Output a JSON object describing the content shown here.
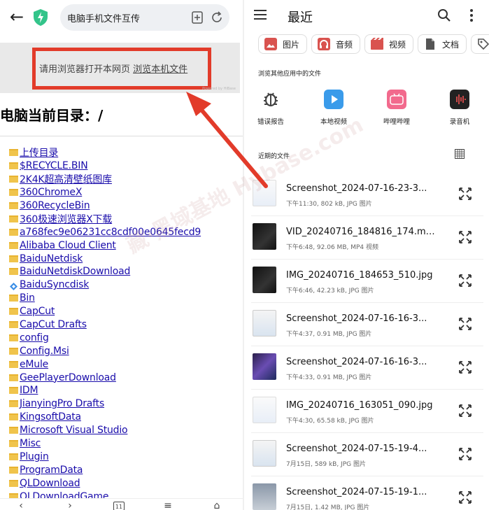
{
  "browser": {
    "url_text": "电脑手机文件互传",
    "banner_text": "请用浏览器打开本网页",
    "banner_link": "浏览本机文件",
    "powered": "Powered by HiBase",
    "dir_title": "电脑当前目录：/",
    "items": [
      {
        "name": "上传目录",
        "icon": "folder-icon"
      },
      {
        "name": "$RECYCLE.BIN",
        "icon": "folder-icon"
      },
      {
        "name": "2K4K超高清壁纸图库",
        "icon": "folder-icon"
      },
      {
        "name": "360ChromeX",
        "icon": "folder-icon"
      },
      {
        "name": "360RecycleBin",
        "icon": "folder-icon"
      },
      {
        "name": "360极速浏览器X下载",
        "icon": "folder-icon"
      },
      {
        "name": "a768fec9e06231cc8cdf00e0645fecd9",
        "icon": "folder-icon"
      },
      {
        "name": "Alibaba Cloud Client",
        "icon": "folder-icon"
      },
      {
        "name": "BaiduNetdisk",
        "icon": "folder-icon"
      },
      {
        "name": "BaiduNetdiskDownload",
        "icon": "folder-icon"
      },
      {
        "name": "BaiduSyncdisk",
        "icon": "sync-folder-icon"
      },
      {
        "name": "Bin",
        "icon": "folder-icon"
      },
      {
        "name": "CapCut",
        "icon": "folder-icon"
      },
      {
        "name": "CapCut Drafts",
        "icon": "folder-icon"
      },
      {
        "name": "config",
        "icon": "folder-icon"
      },
      {
        "name": "Config.Msi",
        "icon": "folder-icon"
      },
      {
        "name": "eMule",
        "icon": "folder-icon"
      },
      {
        "name": "GeePlayerDownload",
        "icon": "folder-icon"
      },
      {
        "name": "IDM",
        "icon": "folder-icon"
      },
      {
        "name": "JianyingPro Drafts",
        "icon": "folder-icon"
      },
      {
        "name": "KingsoftData",
        "icon": "folder-icon"
      },
      {
        "name": "Microsoft Visual Studio",
        "icon": "folder-icon"
      },
      {
        "name": "Misc",
        "icon": "folder-icon"
      },
      {
        "name": "Plugin",
        "icon": "folder-icon"
      },
      {
        "name": "ProgramData",
        "icon": "folder-icon"
      },
      {
        "name": "QLDownload",
        "icon": "folder-icon"
      },
      {
        "name": "QLDownloadGame",
        "icon": "folder-icon"
      }
    ],
    "bottom_nav": [
      {
        "icon": "back-icon"
      },
      {
        "icon": "forward-icon"
      },
      {
        "icon": "tabs-icon",
        "label": "11"
      },
      {
        "icon": "menu-icon"
      },
      {
        "icon": "home-icon"
      }
    ]
  },
  "watermark": "藏·黑域基地 Hybase.com",
  "files_app": {
    "title": "最近",
    "chips": [
      {
        "label": "图片",
        "icon": "image-icon",
        "color": "#d9534f"
      },
      {
        "label": "音频",
        "icon": "headphones-icon",
        "color": "#d9534f"
      },
      {
        "label": "视频",
        "icon": "video-icon",
        "color": "#d9534f"
      },
      {
        "label": "文档",
        "icon": "document-icon",
        "color": "#555555"
      },
      {
        "label": "",
        "icon": "tag-icon",
        "color": "#555555"
      }
    ],
    "browse_label": "浏览其他应用中的文件",
    "apps": [
      {
        "label": "错误报告",
        "icon": "bug-icon",
        "color": "#444444"
      },
      {
        "label": "本地视频",
        "icon": "play-icon",
        "color": "#3a9bea"
      },
      {
        "label": "哔哩哔哩",
        "icon": "bilibili-icon",
        "color": "#f26a8d"
      },
      {
        "label": "录音机",
        "icon": "recorder-icon",
        "color": "#222222"
      }
    ],
    "recent_label": "近期的文件",
    "recent": [
      {
        "name": "Screenshot_2024-07-16-23-3...",
        "meta": "下午11:30, 802 kB, JPG 图片",
        "thumb": "light"
      },
      {
        "name": "VID_20240716_184816_174.mp...",
        "meta": "下午6:48, 92.06 MB, MP4 视频",
        "thumb": "dark"
      },
      {
        "name": "IMG_20240716_184653_510.jpg",
        "meta": "下午6:46, 42.23 kB, JPG 图片",
        "thumb": "dark"
      },
      {
        "name": "Screenshot_2024-07-16-16-3...",
        "meta": "下午4:37, 0.91 MB, JPG 图片",
        "thumb": "ui"
      },
      {
        "name": "Screenshot_2024-07-16-16-3...",
        "meta": "下午4:33, 0.91 MB, JPG 图片",
        "thumb": "purple"
      },
      {
        "name": "IMG_20240716_163051_090.jpg",
        "meta": "下午4:30, 65.58 kB, JPG 图片",
        "thumb": "light"
      },
      {
        "name": "Screenshot_2024-07-15-19-4...",
        "meta": "7月15日, 589 kB, JPG 图片",
        "thumb": "ui"
      },
      {
        "name": "Screenshot_2024-07-15-19-1...",
        "meta": "7月15日, 1.42 MB, JPG 图片",
        "thumb": "phone"
      }
    ]
  }
}
